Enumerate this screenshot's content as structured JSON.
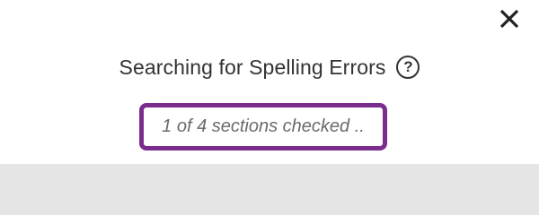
{
  "dialog": {
    "title": "Searching for Spelling Errors",
    "help_symbol": "?",
    "status_text": "1 of 4 sections checked .."
  },
  "icons": {
    "close": "close-icon",
    "help": "help-icon"
  },
  "colors": {
    "highlight_border": "#7b2d8e",
    "title_text": "#333333",
    "status_text": "#6a6a6a",
    "panel_background": "#ffffff",
    "page_background": "#e5e5e5"
  }
}
